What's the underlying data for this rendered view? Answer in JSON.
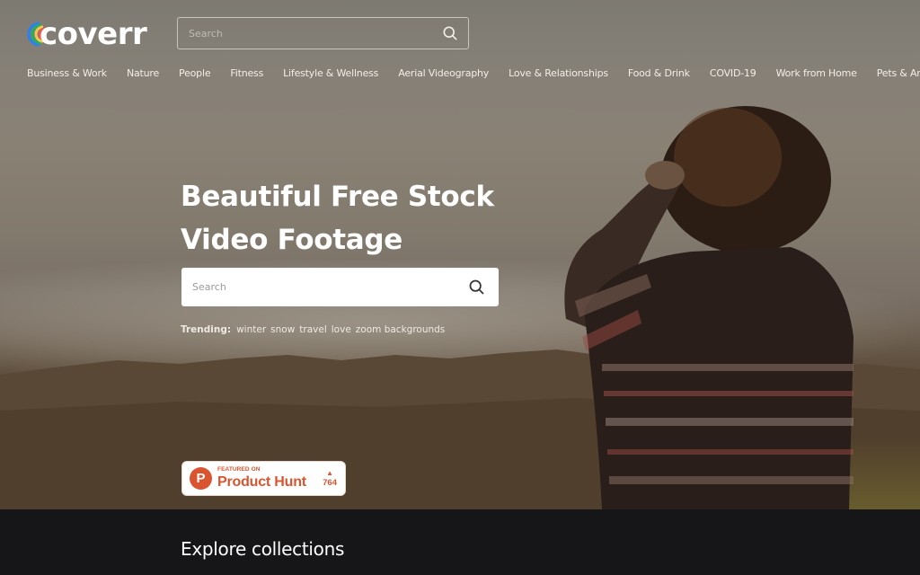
{
  "brand": {
    "name": "coverr",
    "accent": "#da552f"
  },
  "header": {
    "search_placeholder": "Search"
  },
  "nav": {
    "items": [
      "Business & Work",
      "Nature",
      "People",
      "Fitness",
      "Lifestyle & Wellness",
      "Aerial Videography",
      "Love & Relationships",
      "Food & Drink",
      "COVID-19",
      "Work from Home",
      "Pets & Animals"
    ]
  },
  "hero": {
    "title_line1": "Beautiful Free Stock",
    "title_line2": "Video Footage",
    "search_placeholder": "Search",
    "trending_label": "Trending:",
    "trending": [
      "winter",
      "snow",
      "travel",
      "love",
      "zoom backgrounds"
    ]
  },
  "product_hunt": {
    "letter": "P",
    "featured_on": "FEATURED ON",
    "name": "Product Hunt",
    "arrow": "▲",
    "votes": "764"
  },
  "explore": {
    "title": "Explore collections"
  }
}
